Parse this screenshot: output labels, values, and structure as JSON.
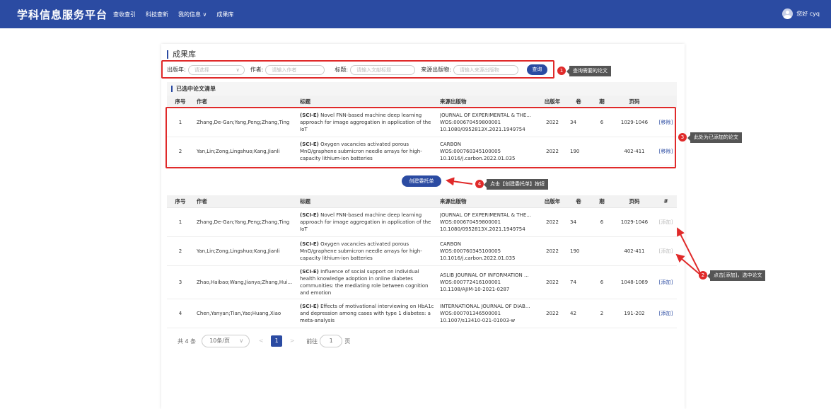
{
  "header": {
    "logo": "学科信息服务平台",
    "nav": [
      "查收查引",
      "科技查新",
      "我的信息 ∨",
      "成果库"
    ],
    "user": "您好 cyq"
  },
  "page": {
    "title": "成果库",
    "filters": {
      "year_label": "出版年:",
      "year_placeholder": "请选择",
      "author_label": "作者:",
      "author_placeholder": "请输入作者",
      "title_label": "标题:",
      "title_placeholder": "请输入文献标题",
      "source_label": "来源出版物:",
      "source_placeholder": "请输入来源出版物",
      "query_button": "查询"
    },
    "selected_title": "已选中论文清单",
    "create_button": "创建委托单"
  },
  "annotations": [
    {
      "num": "1",
      "text": "查询需要的论文"
    },
    {
      "num": "3",
      "text": "此处为已添加的论文"
    },
    {
      "num": "4",
      "text": "点击【创建委托单】按钮"
    },
    {
      "num": "2",
      "text": "点击[添加]，选中论文"
    }
  ],
  "selected_table": {
    "headers": [
      "序号",
      "作者",
      "标题",
      "来源出版物",
      "出版年",
      "卷",
      "期",
      "页码",
      ""
    ],
    "rows": [
      {
        "no": "1",
        "author": "Zhang,De-Gan;Yang,Peng;Zhang,Ting",
        "tag": "(SCI-E)",
        "title": " Novel FNN-based machine deep learning approach for image aggregation in application of the IoT",
        "src1": "JOURNAL OF EXPERIMENTAL & THE...",
        "src2": "WOS:000670459800001",
        "src3": "10.1080/0952813X.2021.1949754",
        "year": "2022",
        "vol": "34",
        "issue": "6",
        "pages": "1029-1046",
        "op": "[移除]"
      },
      {
        "no": "2",
        "author": "Yan,Lin;Zong,Lingshuo;Kang,Jianli",
        "tag": "(SCI-E)",
        "title": " Oxygen vacancies activated porous MnO/graphene submicron needle arrays for high-capacity lithium-ion batteries",
        "src1": "CARBON",
        "src2": "WOS:000760345100005",
        "src3": "10.1016/j.carbon.2022.01.035",
        "year": "2022",
        "vol": "190",
        "issue": "",
        "pages": "402-411",
        "op": "[移除]"
      }
    ]
  },
  "result_table": {
    "headers": [
      "序号",
      "作者",
      "标题",
      "来源出版物",
      "出版年",
      "卷",
      "期",
      "页码",
      "#"
    ],
    "rows": [
      {
        "no": "1",
        "author": "Zhang,De-Gan;Yang,Peng;Zhang,Ting",
        "tag": "(SCI-E)",
        "title": " Novel FNN-based machine deep learning approach for image aggregation in application of the IoT",
        "src1": "JOURNAL OF EXPERIMENTAL & THE...",
        "src2": "WOS:000670459800001",
        "src3": "10.1080/0952813X.2021.1949754",
        "year": "2022",
        "vol": "34",
        "issue": "6",
        "pages": "1029-1046",
        "op": "[添加]",
        "disabled": true
      },
      {
        "no": "2",
        "author": "Yan,Lin;Zong,Lingshuo;Kang,Jianli",
        "tag": "(SCI-E)",
        "title": " Oxygen vacancies activated porous MnO/graphene submicron needle arrays for high-capacity lithium-ion batteries",
        "src1": "CARBON",
        "src2": "WOS:000760345100005",
        "src3": "10.1016/j.carbon.2022.01.035",
        "year": "2022",
        "vol": "190",
        "issue": "",
        "pages": "402-411",
        "op": "[添加]",
        "disabled": true
      },
      {
        "no": "3",
        "author": "Zhao,Haibao;Wang,Jianya;Zhang,Hui...",
        "tag": "(SCI-E)",
        "title": " Influence of social support on individual health knowledge adoption in online diabetes communities: the mediating role between cognition and emotion",
        "src1": "ASLIB JOURNAL OF INFORMATION ...",
        "src2": "WOS:000772416100001",
        "src3": "10.1108/AJIM-10-2021-0287",
        "year": "2022",
        "vol": "74",
        "issue": "6",
        "pages": "1048-1069",
        "op": "[添加]",
        "disabled": false
      },
      {
        "no": "4",
        "author": "Chen,Yanyan;Tian,Yao;Huang,Xiao",
        "tag": "(SCI-E)",
        "title": " Effects of motivational interviewing on HbA1c and depression among cases with type 1 diabetes: a meta-analysis",
        "src1": "INTERNATIONAL JOURNAL OF DIAB...",
        "src2": "WOS:000701346500001",
        "src3": "10.1007/s13410-021-01003-w",
        "year": "2022",
        "vol": "42",
        "issue": "2",
        "pages": "191-202",
        "op": "[添加]",
        "disabled": false
      }
    ]
  },
  "pagination": {
    "total": "共 4 条",
    "page_size": "10条/页",
    "current": "1",
    "goto_label": "前往",
    "goto_value": "1",
    "page_unit": "页"
  },
  "colors": {
    "primary": "#2b4ba2",
    "annotation": "#e02a2a"
  }
}
